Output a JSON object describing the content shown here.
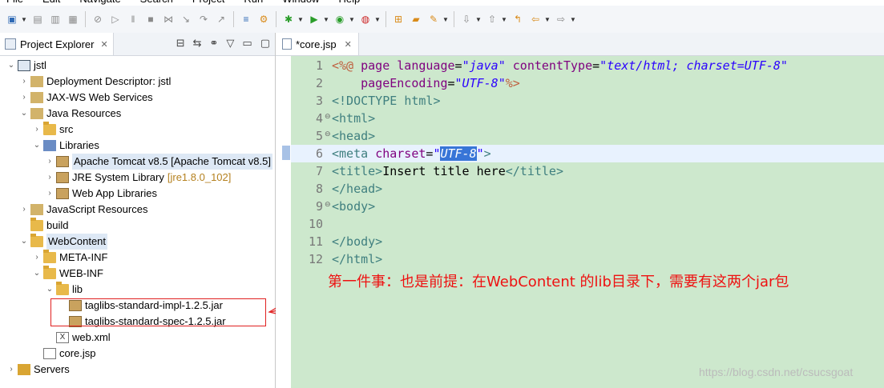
{
  "menu": [
    "File",
    "Edit",
    "Navigate",
    "Search",
    "Project",
    "Run",
    "Window",
    "Help"
  ],
  "explorer": {
    "title": "Project Explorer",
    "tree": [
      {
        "label": "jstl",
        "depth": 0,
        "expanded": true,
        "icon": "project-icon"
      },
      {
        "label": "Deployment Descriptor: jstl",
        "depth": 1,
        "expanded": false,
        "icon": "descriptor-icon"
      },
      {
        "label": "JAX-WS Web Services",
        "depth": 1,
        "expanded": false,
        "icon": "webservice-icon"
      },
      {
        "label": "Java Resources",
        "depth": 1,
        "expanded": true,
        "icon": "java-resources-icon"
      },
      {
        "label": "src",
        "depth": 2,
        "expanded": false,
        "icon": "package-folder-icon"
      },
      {
        "label": "Libraries",
        "depth": 2,
        "expanded": true,
        "icon": "libraries-icon"
      },
      {
        "label": "Apache Tomcat v8.5 [Apache Tomcat v8.5]",
        "depth": 3,
        "expanded": false,
        "icon": "library-icon",
        "selected": true
      },
      {
        "label": "JRE System Library",
        "suffix": "[jre1.8.0_102]",
        "depth": 3,
        "expanded": false,
        "icon": "library-icon"
      },
      {
        "label": "Web App Libraries",
        "depth": 3,
        "expanded": false,
        "icon": "library-icon"
      },
      {
        "label": "JavaScript Resources",
        "depth": 1,
        "expanded": false,
        "icon": "js-resources-icon"
      },
      {
        "label": "build",
        "depth": 1,
        "leaf": true,
        "icon": "folder-icon"
      },
      {
        "label": "WebContent",
        "depth": 1,
        "expanded": true,
        "icon": "folder-open-icon",
        "selected": true
      },
      {
        "label": "META-INF",
        "depth": 2,
        "expanded": false,
        "icon": "folder-icon"
      },
      {
        "label": "WEB-INF",
        "depth": 2,
        "expanded": true,
        "icon": "folder-open-icon"
      },
      {
        "label": "lib",
        "depth": 3,
        "expanded": true,
        "icon": "folder-open-icon"
      },
      {
        "label": "taglibs-standard-impl-1.2.5.jar",
        "depth": 4,
        "leaf": true,
        "icon": "jar-icon"
      },
      {
        "label": "taglibs-standard-spec-1.2.5.jar",
        "depth": 4,
        "leaf": true,
        "icon": "jar-icon"
      },
      {
        "label": "web.xml",
        "depth": 3,
        "leaf": true,
        "icon": "xml-file-icon"
      },
      {
        "label": "core.jsp",
        "depth": 2,
        "leaf": true,
        "icon": "jsp-file-icon"
      },
      {
        "label": "Servers",
        "depth": 0,
        "expanded": false,
        "icon": "servers-icon"
      }
    ]
  },
  "editor": {
    "tab_label": "*core.jsp",
    "lines": [
      {
        "n": "1",
        "fold": "",
        "tokens": [
          [
            "t-dir",
            "<%@ "
          ],
          [
            "t-attr",
            "page "
          ],
          [
            "t-attr",
            "language"
          ],
          [
            "t-txt",
            "="
          ],
          [
            "t-val",
            "\"java\""
          ],
          [
            "t-txt",
            " "
          ],
          [
            "t-attr",
            "contentType"
          ],
          [
            "t-txt",
            "="
          ],
          [
            "t-val",
            "\"text/html; charset=UTF-8\""
          ]
        ]
      },
      {
        "n": "2",
        "fold": "",
        "tokens": [
          [
            "t-txt",
            "    "
          ],
          [
            "t-attr",
            "pageEncoding"
          ],
          [
            "t-txt",
            "="
          ],
          [
            "t-val",
            "\"UTF-8\""
          ],
          [
            "t-dir",
            "%>"
          ]
        ]
      },
      {
        "n": "3",
        "fold": "",
        "tokens": [
          [
            "t-tag",
            "<!DOCTYPE "
          ],
          [
            "t-tag",
            "html"
          ],
          [
            "t-tag",
            ">"
          ]
        ]
      },
      {
        "n": "4",
        "fold": "⊖",
        "tokens": [
          [
            "t-tag",
            "<html>"
          ]
        ]
      },
      {
        "n": "5",
        "fold": "⊖",
        "tokens": [
          [
            "t-tag",
            "<head>"
          ]
        ]
      },
      {
        "n": "6",
        "fold": "",
        "tokens": [
          [
            "t-tag",
            "<meta "
          ],
          [
            "t-attr",
            "charset"
          ],
          [
            "t-txt",
            "="
          ],
          [
            "t-val",
            "\""
          ],
          [
            "t-sel",
            "UTF-8"
          ],
          [
            "t-val",
            "\""
          ],
          [
            "t-tag",
            ">"
          ]
        ]
      },
      {
        "n": "7",
        "fold": "",
        "tokens": [
          [
            "t-tag",
            "<title>"
          ],
          [
            "t-txt",
            "Insert title here"
          ],
          [
            "t-tag",
            "</title>"
          ]
        ]
      },
      {
        "n": "8",
        "fold": "",
        "tokens": [
          [
            "t-tag",
            "</head>"
          ]
        ]
      },
      {
        "n": "9",
        "fold": "⊖",
        "tokens": [
          [
            "t-tag",
            "<body>"
          ]
        ]
      },
      {
        "n": "10",
        "fold": "",
        "tokens": []
      },
      {
        "n": "11",
        "fold": "",
        "tokens": [
          [
            "t-tag",
            "</body>"
          ]
        ]
      },
      {
        "n": "12",
        "fold": "",
        "tokens": [
          [
            "t-tag",
            "</html>"
          ]
        ]
      }
    ]
  },
  "annotation": {
    "note": "第一件事：也是前提：在WebContent 的lib目录下，需要有这两个jar包",
    "color": "#e11111"
  },
  "watermark": "https://blog.csdn.net/csucsgoat"
}
